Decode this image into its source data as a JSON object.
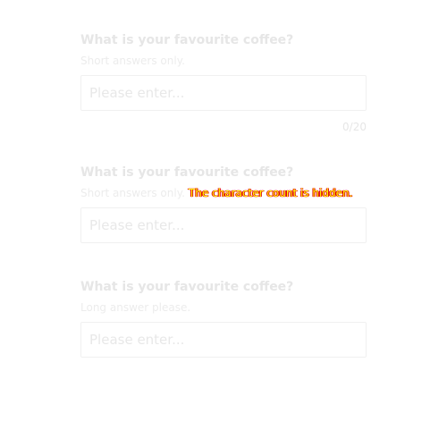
{
  "fields": [
    {
      "title": "What is your favourite coffee?",
      "hint": "Short answers only.",
      "placeholder": "Please enter...",
      "value": "",
      "counter": "0/20"
    },
    {
      "title": "What is your favourite coffee?",
      "hint": "Short answers only.",
      "note": "The character count is hidden.",
      "placeholder": "Please enter...",
      "value": ""
    },
    {
      "title": "What is your favourite coffee?",
      "hint": "Long answer please.",
      "placeholder": "Please enter...",
      "value": ""
    }
  ],
  "colors": {
    "text_faded": "#e6e6e6",
    "note_text": "#ffff00",
    "note_outline": "#e00000",
    "input_border": "#f0f0f0"
  }
}
